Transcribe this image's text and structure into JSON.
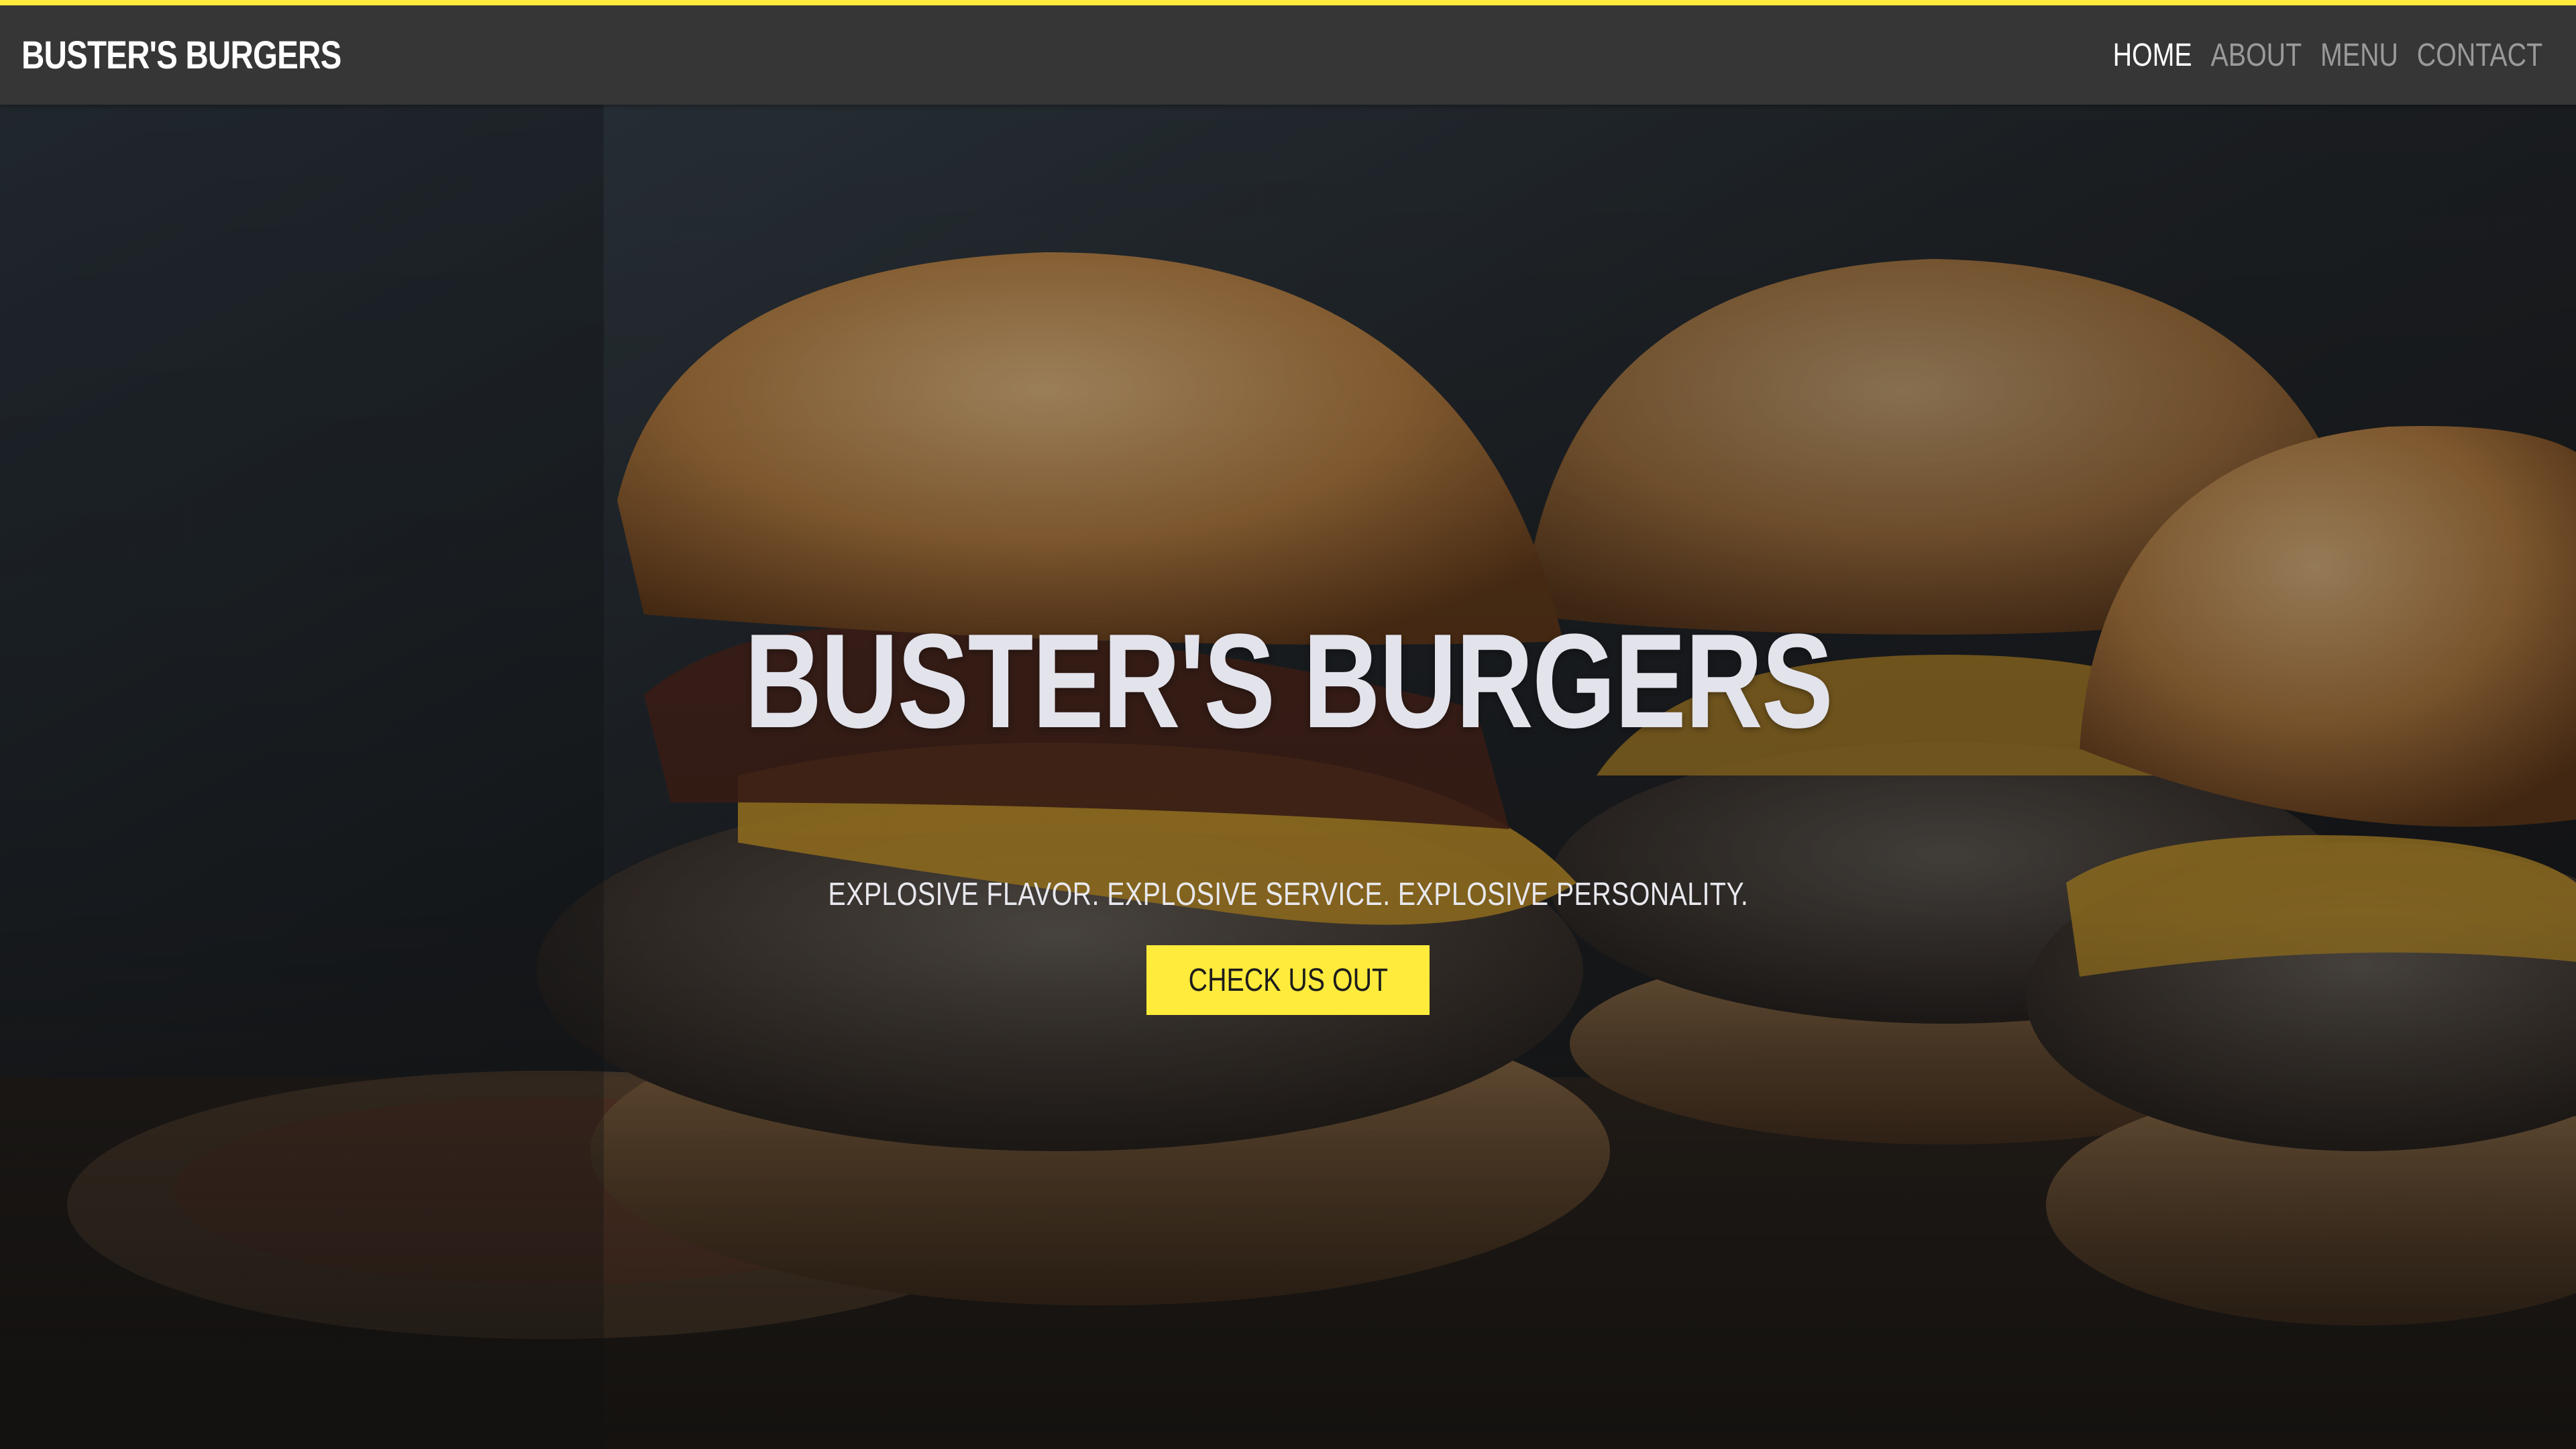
{
  "brand": {
    "name": "BUSTER'S BURGERS"
  },
  "nav": {
    "items": [
      {
        "label": "HOME",
        "active": true
      },
      {
        "label": "ABOUT",
        "active": false
      },
      {
        "label": "MENU",
        "active": false
      },
      {
        "label": "CONTACT",
        "active": false
      }
    ]
  },
  "hero": {
    "title": "BUSTER'S BURGERS",
    "subtitle": "EXPLOSIVE FLAVOR. EXPLOSIVE SERVICE. EXPLOSIVE PERSONALITY.",
    "cta_label": "CHECK US OUT",
    "background_image": "burger-sliders-photo"
  },
  "colors": {
    "accent": "#ffeb3b",
    "navbar": "#363636",
    "nav_active": "#ffffff",
    "nav_inactive": "#9a9a9a",
    "title_text": "#e3e3ec"
  }
}
